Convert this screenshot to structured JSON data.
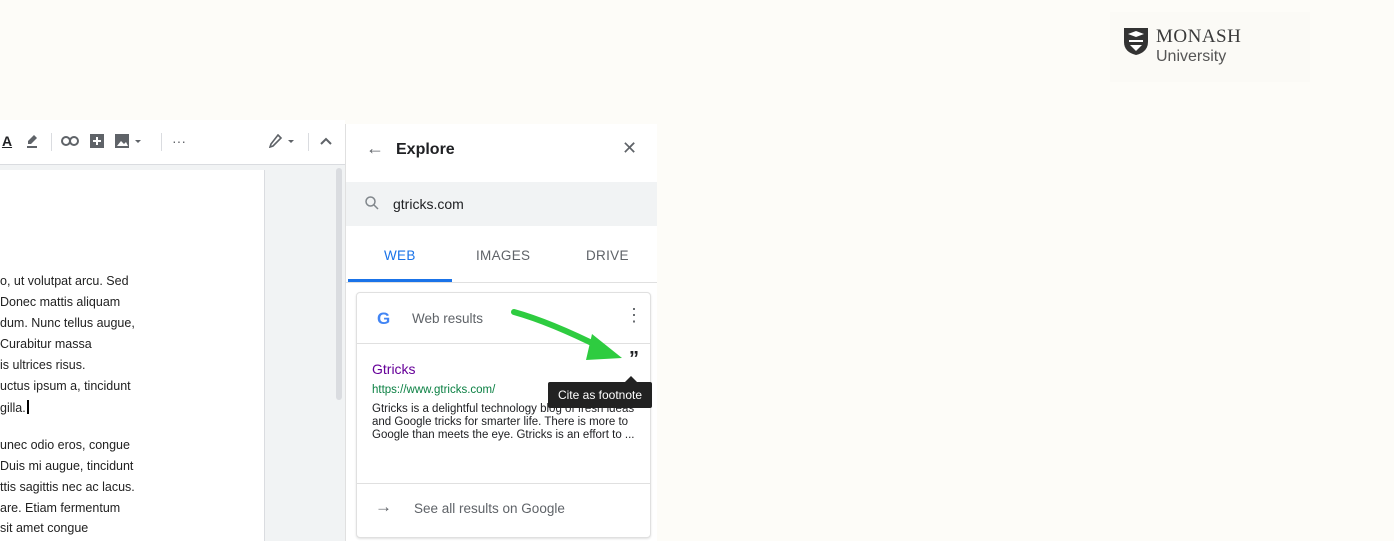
{
  "logo": {
    "line1": "MONASH",
    "line2": "University"
  },
  "toolbar": {
    "text_color_icon": "A",
    "more_label": "···"
  },
  "document": {
    "lines_block1": [
      "o, ut volutpat arcu. Sed",
      "Donec mattis aliquam",
      "dum. Nunc tellus augue,",
      "Curabitur massa",
      "is ultrices risus.",
      "uctus ipsum a, tincidunt",
      "gilla."
    ],
    "lines_block2": [
      "unec odio eros, congue",
      "Duis mi augue, tincidunt",
      "ttis sagittis nec ac lacus.",
      "are. Etiam fermentum",
      "sit amet congue"
    ]
  },
  "explore": {
    "title": "Explore",
    "search_value": "gtricks.com",
    "tabs": [
      "WEB",
      "IMAGES",
      "DRIVE"
    ],
    "active_tab": "WEB",
    "card": {
      "header": "Web results",
      "result_title": "Gtricks",
      "result_url": "https://www.gtricks.com/",
      "result_snippet": "Gtricks is a delightful technology blog of fresh ideas and Google tricks for smarter life. There is more to Google than meets the eye. Gtricks is an effort to ...",
      "see_all": "See all results on Google"
    },
    "tooltip": "Cite as footnote"
  },
  "colors": {
    "accent": "#1a73e8",
    "arrow": "#22c55e",
    "visited_link": "#660099",
    "url": "#0b8043"
  }
}
